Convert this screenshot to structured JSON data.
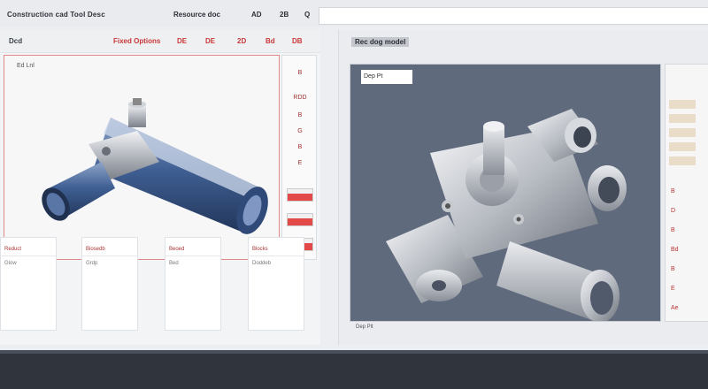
{
  "header": {
    "title": "Construction cad Tool Desc",
    "menu": [
      "Resource doc",
      "AD",
      "2B",
      "Q"
    ],
    "search_value": ""
  },
  "left": {
    "head_labels": [
      "Dcd",
      "Fixed Options",
      "DE",
      "DE",
      "2D",
      "Bd",
      "DB"
    ],
    "viewport_caption": "Ed Lnl",
    "side_labels": [
      "B",
      "RDD",
      "B",
      "G",
      "B",
      "E"
    ],
    "cards": [
      {
        "h1": "Reduct",
        "h2": "Glow"
      },
      {
        "h1": "Biosedb",
        "h2": "Grdp"
      },
      {
        "h1": "Beoed",
        "h2": "Bed"
      },
      {
        "h1": "Blocks",
        "h2": "Doddeb"
      }
    ]
  },
  "right": {
    "title": "Rec dog model",
    "viewport_caption": "Dep Pt",
    "foot": "Dep Plt",
    "side_labels": [
      "B",
      "D",
      "B",
      "Bd",
      "B",
      "E",
      "Ae"
    ]
  }
}
